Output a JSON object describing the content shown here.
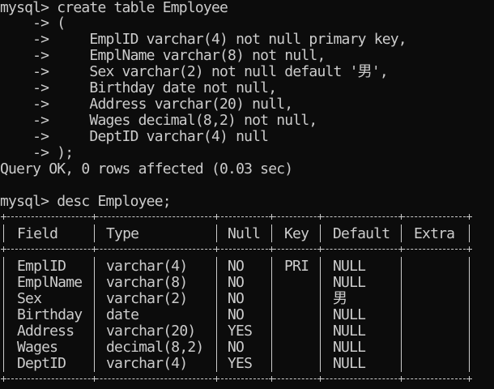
{
  "session": {
    "create_lines": [
      "mysql> create table Employee",
      "    -> (",
      "    ->     EmplID varchar(4) not null primary key,",
      "    ->     EmplName varchar(8) not null,",
      "    ->     Sex varchar(2) not null default '男',",
      "    ->     Birthday date not null,",
      "    ->     Address varchar(20) null,",
      "    ->     Wages decimal(8,2) not null,",
      "    ->     DeptID varchar(4) null",
      "    -> );"
    ],
    "result_line": "Query OK, 0 rows affected (0.03 sec)",
    "desc_command": "mysql> desc Employee;"
  },
  "desc_table": {
    "headers": [
      "Field",
      "Type",
      "Null",
      "Key",
      "Default",
      "Extra"
    ],
    "rows": [
      [
        "EmplID",
        "varchar(4)",
        "NO",
        "PRI",
        "NULL",
        ""
      ],
      [
        "EmplName",
        "varchar(8)",
        "NO",
        "",
        "NULL",
        ""
      ],
      [
        "Sex",
        "varchar(2)",
        "NO",
        "",
        "男",
        ""
      ],
      [
        "Birthday",
        "date",
        "NO",
        "",
        "NULL",
        ""
      ],
      [
        "Address",
        "varchar(20)",
        "YES",
        "",
        "NULL",
        ""
      ],
      [
        "Wages",
        "decimal(8,2)",
        "NO",
        "",
        "NULL",
        ""
      ],
      [
        "DeptID",
        "varchar(4)",
        "YES",
        "",
        "NULL",
        ""
      ]
    ]
  },
  "colors": {
    "background": "#0c0c0c",
    "text": "#cccccc"
  }
}
